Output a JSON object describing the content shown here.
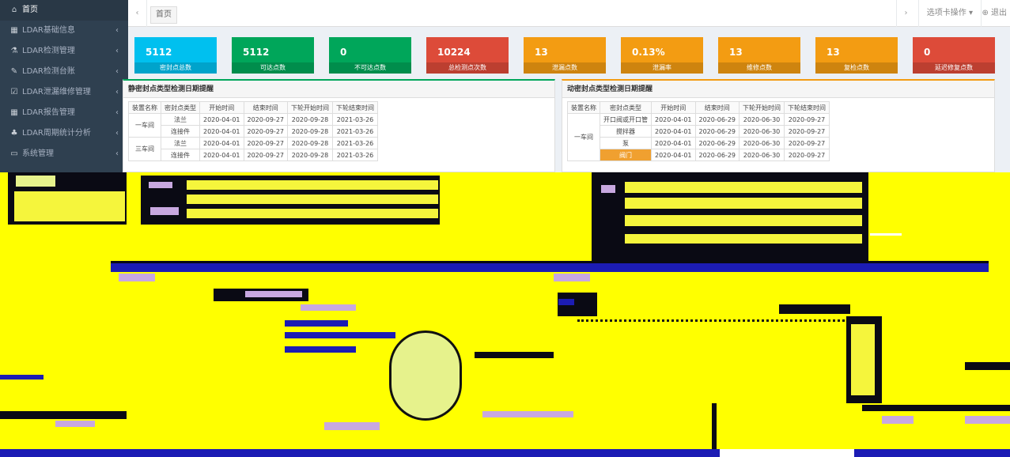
{
  "sidebar": {
    "items": [
      {
        "icon": "bank-icon",
        "glyph": "⌂",
        "label": "首页"
      },
      {
        "icon": "grid-icon",
        "glyph": "▦",
        "label": "LDAR基础信息"
      },
      {
        "icon": "flask-icon",
        "glyph": "⚗",
        "label": "LDAR检测管理"
      },
      {
        "icon": "wrench-icon",
        "glyph": "✎",
        "label": "LDAR检测台账"
      },
      {
        "icon": "checkbox-icon",
        "glyph": "☑",
        "label": "LDAR泄漏维修管理"
      },
      {
        "icon": "grid-icon",
        "glyph": "▦",
        "label": "LDAR报告管理"
      },
      {
        "icon": "sitemap-icon",
        "glyph": "♣",
        "label": "LDAR周期统计分析"
      },
      {
        "icon": "monitor-icon",
        "glyph": "▭",
        "label": "系统管理"
      }
    ]
  },
  "tabbar": {
    "back_icon": "‹",
    "forward_icon": "›",
    "home_tab": "首页",
    "tab_ops": "选项卡操作 ▾",
    "exit": "⊕ 退出"
  },
  "stats": [
    {
      "value": "5112",
      "label": "密封点总数",
      "color": "#00c0ef"
    },
    {
      "value": "5112",
      "label": "可达点数",
      "color": "#00a65a"
    },
    {
      "value": "0",
      "label": "不可达点数",
      "color": "#00a65a"
    },
    {
      "value": "10224",
      "label": "总检测点次数",
      "color": "#dd4b39"
    },
    {
      "value": "13",
      "label": "泄漏点数",
      "color": "#f39c12"
    },
    {
      "value": "0.13%",
      "label": "泄漏率",
      "color": "#f39c12"
    },
    {
      "value": "13",
      "label": "维修点数",
      "color": "#f39c12"
    },
    {
      "value": "13",
      "label": "复检点数",
      "color": "#f39c12"
    },
    {
      "value": "0",
      "label": "延迟修复点数",
      "color": "#dd4b39"
    }
  ],
  "static_panel": {
    "title": "静密封点类型检测日期提醒",
    "headers": [
      "装置名称",
      "密封点类型",
      "开始时间",
      "结束时间",
      "下轮开始时间",
      "下轮结束时间"
    ],
    "groups": [
      {
        "name": "一车间",
        "rows": [
          [
            "法兰",
            "2020-04-01",
            "2020-09-27",
            "2020-09-28",
            "2021-03-26"
          ],
          [
            "连接件",
            "2020-04-01",
            "2020-09-27",
            "2020-09-28",
            "2021-03-26"
          ]
        ]
      },
      {
        "name": "三车间",
        "rows": [
          [
            "法兰",
            "2020-04-01",
            "2020-09-27",
            "2020-09-28",
            "2021-03-26"
          ],
          [
            "连接件",
            "2020-04-01",
            "2020-09-27",
            "2020-09-28",
            "2021-03-26"
          ]
        ]
      }
    ]
  },
  "dynamic_panel": {
    "title": "动密封点类型检测日期提醒",
    "headers": [
      "装置名称",
      "密封点类型",
      "开始时间",
      "结束时间",
      "下轮开始时间",
      "下轮结束时间"
    ],
    "groups": [
      {
        "name": "一车间",
        "rows": [
          [
            "开口阀或开口管",
            "2020-04-01",
            "2020-06-29",
            "2020-06-30",
            "2020-09-27"
          ],
          [
            "搅拌器",
            "2020-04-01",
            "2020-06-29",
            "2020-06-30",
            "2020-09-27"
          ],
          [
            "泵",
            "2020-04-01",
            "2020-06-29",
            "2020-06-30",
            "2020-09-27"
          ],
          [
            "阀门",
            "2020-04-01",
            "2020-06-29",
            "2020-06-30",
            "2020-09-27"
          ]
        ]
      }
    ]
  }
}
